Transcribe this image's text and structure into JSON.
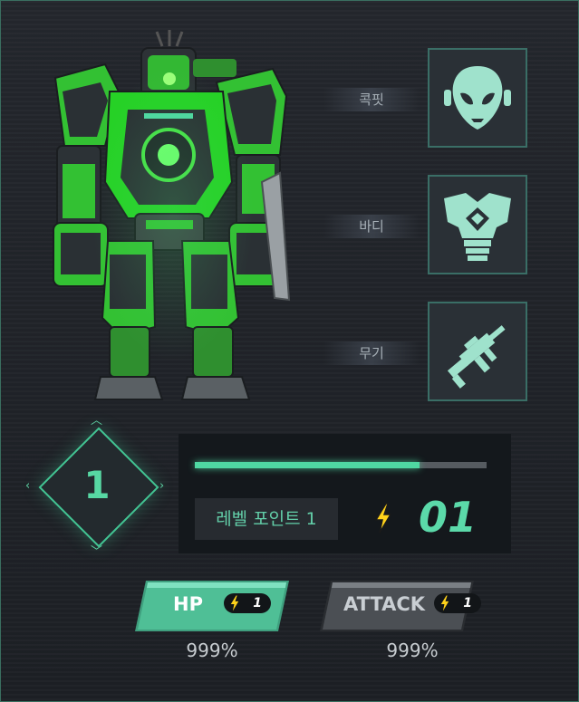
{
  "parts": [
    {
      "label": "콕핏",
      "icon": "alien-head-icon"
    },
    {
      "label": "바디",
      "icon": "body-armor-icon"
    },
    {
      "label": "무기",
      "icon": "rifle-icon"
    }
  ],
  "level": {
    "value": "1"
  },
  "xp": {
    "progress": 0.77
  },
  "level_point": {
    "label": "레벨 포인트 1",
    "value": "01",
    "icon": "lightning-bolt-icon"
  },
  "stats": [
    {
      "name": "HP",
      "cost": "1",
      "percent": "999%",
      "selected": true
    },
    {
      "name": "ATTACK",
      "cost": "1",
      "percent": "999%",
      "selected": false
    }
  ],
  "colors": {
    "accent": "#4fd8a2",
    "robot_green": "#3ad83a",
    "bolt": "#ffd21a"
  }
}
